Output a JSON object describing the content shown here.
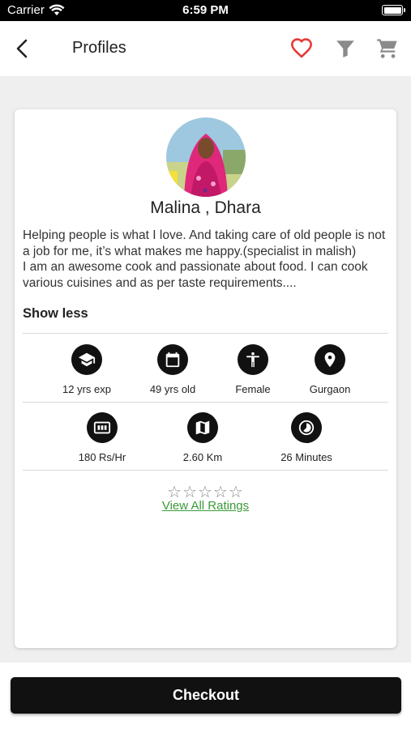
{
  "status_bar": {
    "carrier": "Carrier",
    "time": "6:59 PM"
  },
  "header": {
    "title": "Profiles",
    "icons": [
      "back-arrow-icon",
      "heart-icon",
      "filter-icon",
      "cart-icon"
    ]
  },
  "profile": {
    "name": "Malina , Dhara",
    "bio": " Helping people is what I love. And taking care of old people is not a job for me, it’s what makes me happy.(specialist in malish)\nI am an awesome cook and passionate about food. I can cook various cuisines and as per taste requirements....",
    "show_less": "Show less",
    "stats_row1": [
      {
        "icon": "graduation-cap-icon",
        "label": "12 yrs exp"
      },
      {
        "icon": "calendar-icon",
        "label": "49 yrs old"
      },
      {
        "icon": "person-icon",
        "label": "Female"
      },
      {
        "icon": "location-pin-icon",
        "label": "Gurgaon"
      }
    ],
    "stats_row2": [
      {
        "icon": "money-icon",
        "label": "180 Rs/Hr"
      },
      {
        "icon": "map-icon",
        "label": "2.60 Km"
      },
      {
        "icon": "timer-icon",
        "label": "26 Minutes"
      }
    ],
    "rating": {
      "stars": "☆☆☆☆☆",
      "value": 0,
      "max": 5
    },
    "view_all_ratings": "View All Ratings"
  },
  "footer": {
    "checkout_label": "Checkout"
  },
  "colors": {
    "accent_heart": "#e53935",
    "link_green": "#3a9a3a",
    "button_dark": "#111111"
  }
}
